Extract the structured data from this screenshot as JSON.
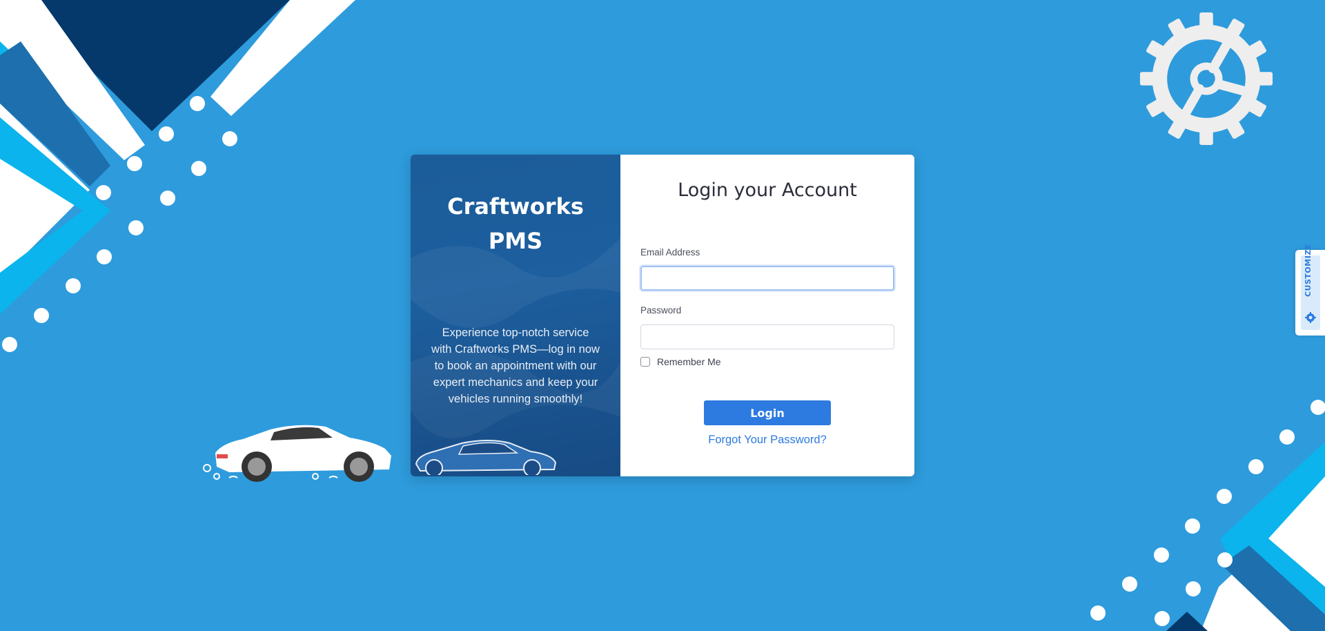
{
  "brand": {
    "title_line1": "Craftworks",
    "title_line2": "PMS",
    "description": "Experience top-notch service with Craftworks PMS—log in now to book an appointment with our expert mechanics and keep your vehicles running smoothly!"
  },
  "form": {
    "title": "Login your Account",
    "email_label": "Email Address",
    "email_value": "",
    "password_label": "Password",
    "password_value": "",
    "remember_label": "Remember Me",
    "remember_checked": false,
    "login_label": "Login",
    "forgot_label": "Forgot Your Password?"
  },
  "customize": {
    "label": "CUSTOMIZE",
    "icon": "gear-icon"
  },
  "colors": {
    "background": "#2e9bdc",
    "accent": "#2d7ae0",
    "brand_panel": "#1d5f9f"
  }
}
